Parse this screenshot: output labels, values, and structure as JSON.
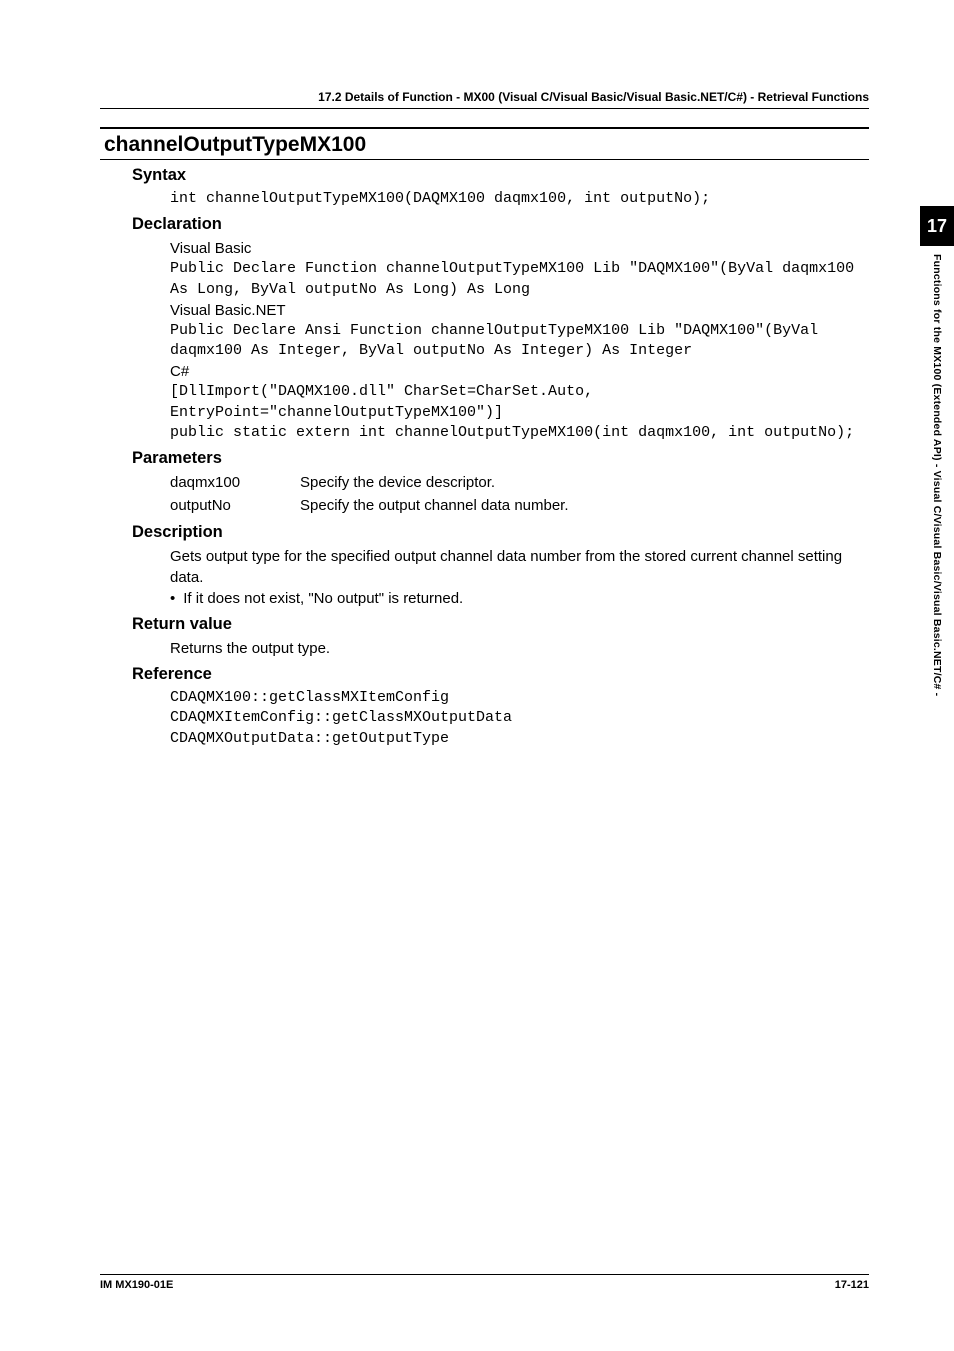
{
  "topHeader": "17.2  Details of  Function - MX00 (Visual C/Visual Basic/Visual Basic.NET/C#) - Retrieval Functions",
  "mainHeading": "channelOutputTypeMX100",
  "syntax": {
    "heading": "Syntax",
    "code": "int channelOutputTypeMX100(DAQMX100 daqmx100, int outputNo);"
  },
  "declaration": {
    "heading": "Declaration",
    "vb_label": "Visual Basic",
    "vb_code": "Public Declare Function channelOutputTypeMX100 Lib \"DAQMX100\"(ByVal daqmx100 As Long, ByVal outputNo As Long) As Long",
    "vbnet_label": "Visual Basic.NET",
    "vbnet_code": "Public Declare Ansi Function channelOutputTypeMX100 Lib \"DAQMX100\"(ByVal daqmx100 As Integer, ByVal outputNo As Integer) As Integer",
    "cs_label": "C#",
    "cs_code": "[DllImport(\"DAQMX100.dll\" CharSet=CharSet.Auto, EntryPoint=\"channelOutputTypeMX100\")]\npublic static extern int channelOutputTypeMX100(int daqmx100, int outputNo);"
  },
  "parameters": {
    "heading": "Parameters",
    "rows": [
      {
        "name": "daqmx100",
        "desc": "Specify the device descriptor."
      },
      {
        "name": "outputNo",
        "desc": "Specify the output channel data number."
      }
    ]
  },
  "description": {
    "heading": "Description",
    "text": "Gets output type for the specified output channel data number from the stored current channel setting data.",
    "bullet": "If it does not exist, \"No output\" is returned."
  },
  "returnValue": {
    "heading": "Return value",
    "text": "Returns the output type."
  },
  "reference": {
    "heading": "Reference",
    "code": "CDAQMX100::getClassMXItemConfig\nCDAQMXItemConfig::getClassMXOutputData\nCDAQMXOutputData::getOutputType"
  },
  "sideTab": {
    "number": "17",
    "text": "Functions for the MX100 (Extended API) - Visual C/Visual Basic/Visual Basic.NET/C# -"
  },
  "footer": {
    "left": "IM MX190-01E",
    "right": "17-121"
  }
}
